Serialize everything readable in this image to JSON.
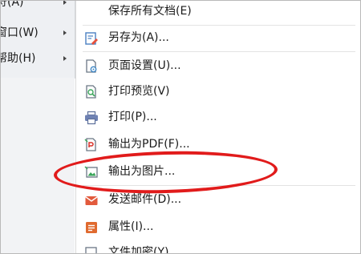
{
  "parent_menu": {
    "items": [
      {
        "label": "符(A)"
      },
      {
        "label": "窗口(W)"
      },
      {
        "label": "帮助(H)"
      }
    ]
  },
  "submenu": {
    "items": [
      {
        "label": "保存所有文档(E)",
        "icon": "save-all-icon"
      },
      {
        "label": "另存为(A)...",
        "icon": "save-as-icon"
      },
      {
        "label": "页面设置(U)...",
        "icon": "page-setup-icon"
      },
      {
        "label": "打印预览(V)",
        "icon": "print-preview-icon"
      },
      {
        "label": "打印(P)...",
        "icon": "printer-icon"
      },
      {
        "label": "输出为PDF(F)...",
        "icon": "export-pdf-icon"
      },
      {
        "label": "输出为图片...",
        "icon": "export-image-icon"
      },
      {
        "label": "发送邮件(D)...",
        "icon": "mail-icon"
      },
      {
        "label": "属性(I)...",
        "icon": "properties-icon"
      },
      {
        "label": "文件加密(Y)",
        "icon": "encrypt-icon"
      }
    ]
  },
  "annotation": {
    "color": "#e11b1b"
  }
}
